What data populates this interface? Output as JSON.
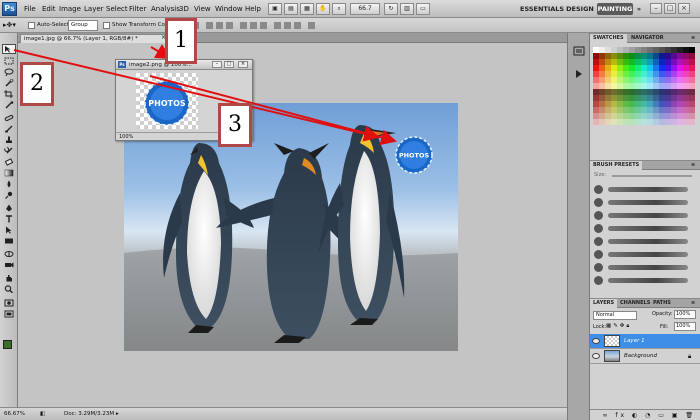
{
  "app": {
    "logo_text": "Ps",
    "menus": [
      "File",
      "Edit",
      "Image",
      "Layer",
      "Select",
      "Filter",
      "Analysis",
      "3D",
      "View",
      "Window",
      "Help"
    ],
    "zoom": "66.7",
    "workspaces": [
      "ESSENTIALS",
      "DESIGN",
      "PAINTING"
    ],
    "window_controls": [
      "–",
      "□",
      "×"
    ]
  },
  "options": {
    "auto_select_label": "Auto-Select:",
    "auto_select_value": "Group",
    "transform_label": "Show Transform Controls"
  },
  "document": {
    "tab_title": "image1.jpg @ 66.7% (Layer 1, RGB/8#) *",
    "status_zoom": "66.67%",
    "status_doc": "Doc: 3.29M/3.23M"
  },
  "floating_doc": {
    "title": "image2.png @ 100%...",
    "zoom": "100%",
    "badge_text": "PHOTOS"
  },
  "main_image": {
    "badge_text": "PHOTOS"
  },
  "panels": {
    "swatches_tabs": [
      "SWATCHES",
      "NAVIGATOR"
    ],
    "brush_tab": "BRUSH PRESETS",
    "brush_size_label": "Size:",
    "layers_tabs": [
      "LAYERS",
      "CHANNELS",
      "PATHS"
    ],
    "blend_mode": "Normal",
    "opacity_label": "Opacity:",
    "opacity_value": "100%",
    "lock_label": "Lock:",
    "fill_label": "Fill:",
    "fill_value": "100%",
    "layers": [
      {
        "name": "Layer 1",
        "selected": true
      },
      {
        "name": "Background",
        "selected": false
      }
    ]
  },
  "annotations": [
    {
      "label": "1"
    },
    {
      "label": "2"
    },
    {
      "label": "3"
    }
  ],
  "colors": {
    "annotation_border": "#b14848",
    "arrow": "#e01010",
    "layer_selected": "#3d8ee6",
    "foreground": "#3b6e2b",
    "background": "#ffffff"
  }
}
